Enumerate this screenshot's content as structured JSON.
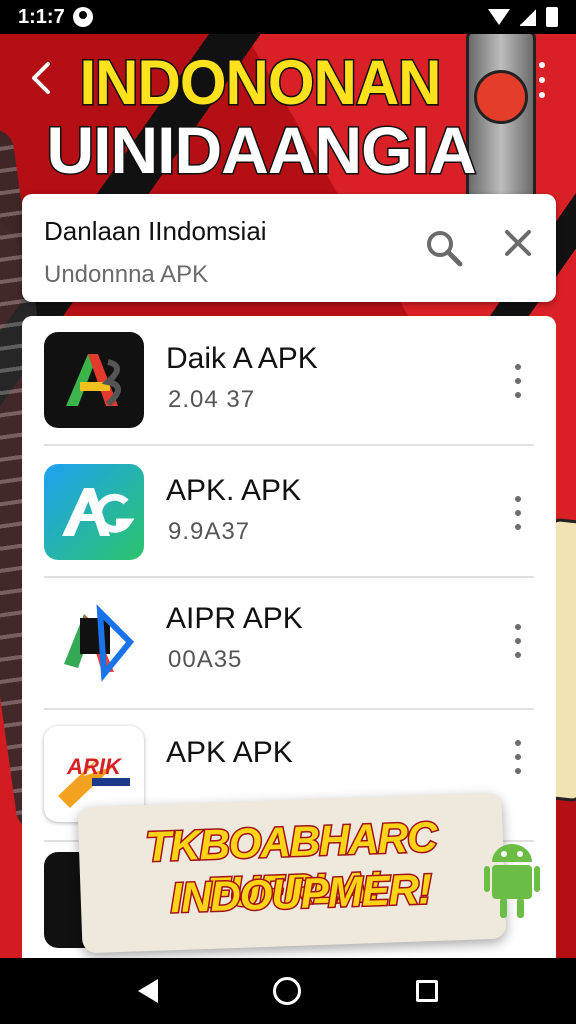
{
  "status_bar": {
    "time": "1:1:7"
  },
  "header": {
    "title_line1": "INDONONAN",
    "title_line2": "UINIDAANGIA"
  },
  "search": {
    "title": "Danlaan IIndomsiai",
    "subtitle": "Undonnna APK"
  },
  "apps": [
    {
      "name": "Daik A APK",
      "meta": "2.04 37",
      "icon": "dark-a-app-icon",
      "colors": [
        "#111111",
        "#3bb54a",
        "#e23b2e",
        "#f2c01e"
      ]
    },
    {
      "name": "APK. APK",
      "meta": "9.9A37",
      "icon": "ag-app-icon",
      "colors": [
        "#1da1f2",
        "#2cc46b"
      ]
    },
    {
      "name": "AIPR APK",
      "meta": "00A35",
      "icon": "aipr-app-icon",
      "colors": [
        "#1a73e8",
        "#34a853",
        "#ea4335"
      ]
    },
    {
      "name": "APK APK",
      "meta": "",
      "icon": "arik-app-icon",
      "logo_text": "ARIK",
      "colors": [
        "#d61f26",
        "#1b3a8a"
      ]
    }
  ],
  "promo": {
    "line1": "TKBOABHARC FUFRLA!",
    "line2": "INDOUPMER!"
  },
  "nav": {
    "back": "back-icon",
    "home": "home-icon",
    "recents": "recents-icon"
  }
}
